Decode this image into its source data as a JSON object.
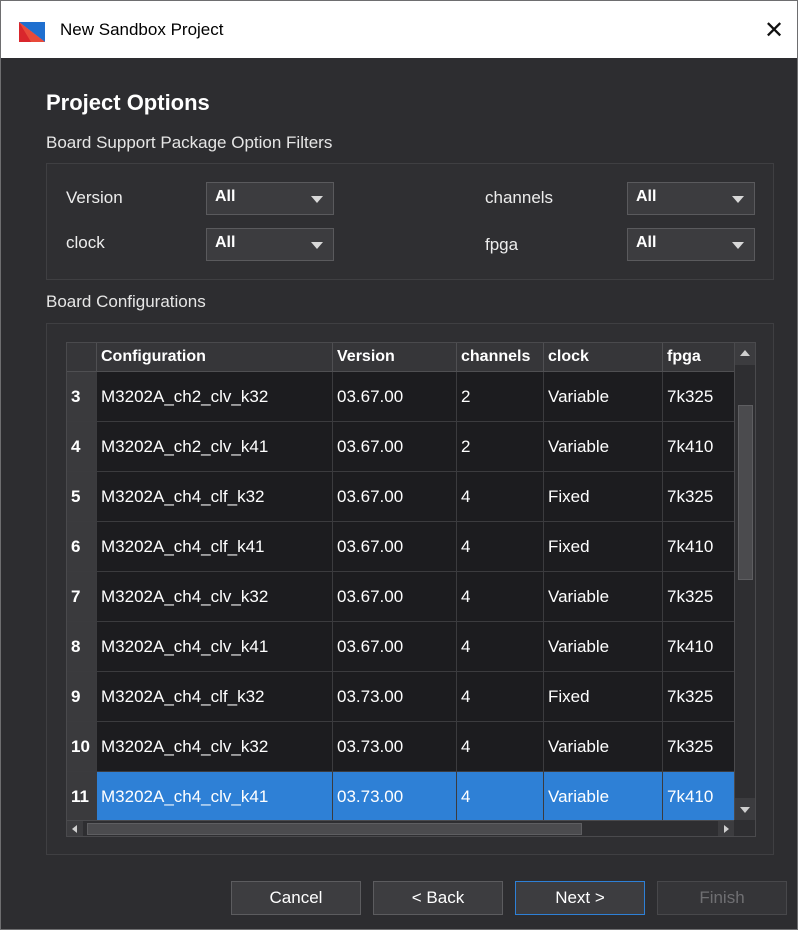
{
  "window": {
    "title": "New Sandbox Project",
    "close_glyph": "✕"
  },
  "page": {
    "title": "Project Options",
    "filters_heading": "Board Support Package Option Filters",
    "configs_heading": "Board Configurations"
  },
  "filters": {
    "version": {
      "label": "Version",
      "value": "All"
    },
    "channels": {
      "label": "channels",
      "value": "All"
    },
    "clock": {
      "label": "clock",
      "value": "All"
    },
    "fpga": {
      "label": "fpga",
      "value": "All"
    }
  },
  "table": {
    "headers": [
      "Configuration",
      "Version",
      "channels",
      "clock",
      "fpga"
    ],
    "rows": [
      {
        "num": "3",
        "configuration": "M3202A_ch2_clv_k32",
        "version": "03.67.00",
        "channels": "2",
        "clock": "Variable",
        "fpga": "7k325"
      },
      {
        "num": "4",
        "configuration": "M3202A_ch2_clv_k41",
        "version": "03.67.00",
        "channels": "2",
        "clock": "Variable",
        "fpga": "7k410"
      },
      {
        "num": "5",
        "configuration": "M3202A_ch4_clf_k32",
        "version": "03.67.00",
        "channels": "4",
        "clock": "Fixed",
        "fpga": "7k325"
      },
      {
        "num": "6",
        "configuration": "M3202A_ch4_clf_k41",
        "version": "03.67.00",
        "channels": "4",
        "clock": "Fixed",
        "fpga": "7k410"
      },
      {
        "num": "7",
        "configuration": "M3202A_ch4_clv_k32",
        "version": "03.67.00",
        "channels": "4",
        "clock": "Variable",
        "fpga": "7k325"
      },
      {
        "num": "8",
        "configuration": "M3202A_ch4_clv_k41",
        "version": "03.67.00",
        "channels": "4",
        "clock": "Variable",
        "fpga": "7k410"
      },
      {
        "num": "9",
        "configuration": "M3202A_ch4_clf_k32",
        "version": "03.73.00",
        "channels": "4",
        "clock": "Fixed",
        "fpga": "7k325"
      },
      {
        "num": "10",
        "configuration": "M3202A_ch4_clv_k32",
        "version": "03.73.00",
        "channels": "4",
        "clock": "Variable",
        "fpga": "7k325"
      },
      {
        "num": "11",
        "configuration": "M3202A_ch4_clv_k41",
        "version": "03.73.00",
        "channels": "4",
        "clock": "Variable",
        "fpga": "7k410"
      }
    ],
    "selected_row": "11"
  },
  "buttons": {
    "cancel": "Cancel",
    "back": "< Back",
    "next": "Next >",
    "finish": "Finish"
  },
  "colors": {
    "accent": "#2e80d6",
    "background": "#2d2d30",
    "table_bg": "#1c1c1f"
  },
  "icons": {
    "app": "app-logo-icon",
    "close": "close-icon",
    "dropdown": "chevron-down-icon"
  }
}
